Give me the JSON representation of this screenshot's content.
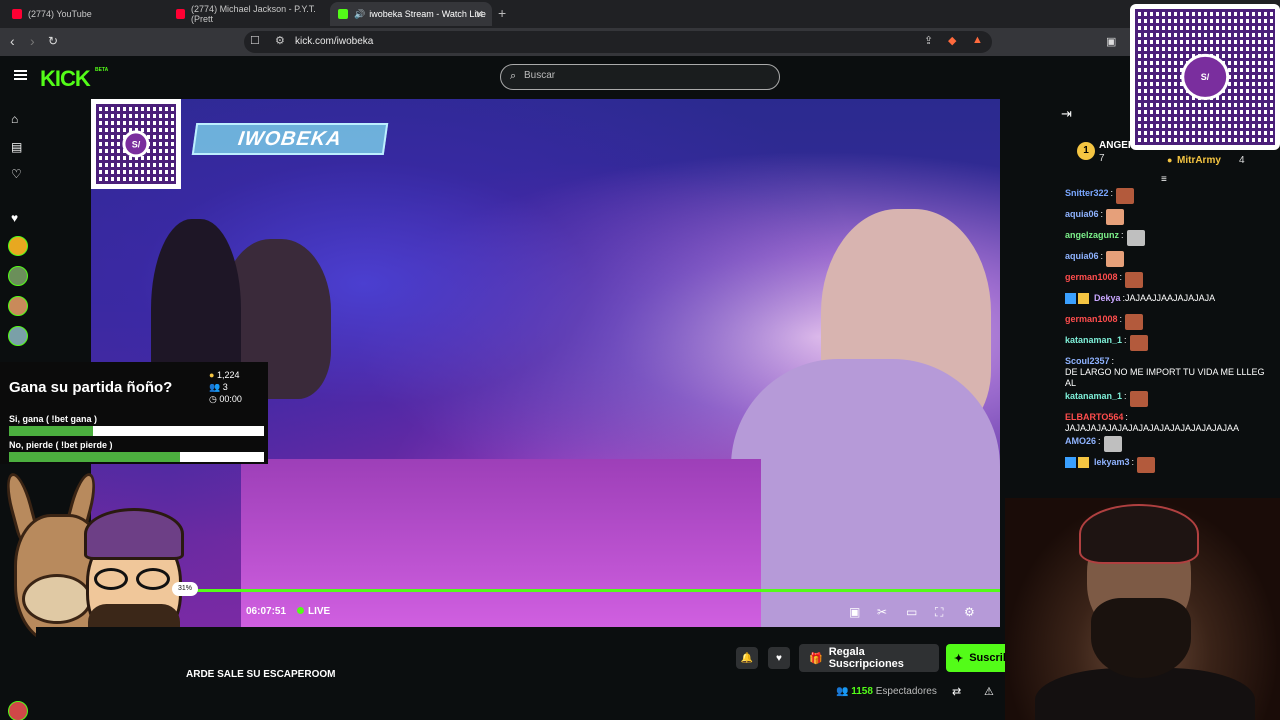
{
  "browser": {
    "tabs": [
      {
        "title": "(2774) YouTube"
      },
      {
        "title": "(2774) Michael Jackson - P.Y.T. (Prett"
      },
      {
        "title": "iwobeka Stream - Watch Live"
      }
    ],
    "url": "kick.com/iwobeka"
  },
  "header": {
    "logo": "KICK",
    "logo_badge": "BETA",
    "search_placeholder": "Buscar"
  },
  "qr": {
    "badge_text": "S/",
    "brand": "yape"
  },
  "video": {
    "channel_banner": "IWOBEKA",
    "elapsed": "06:07:51",
    "live_label": "LIVE"
  },
  "poll": {
    "question": "Gana su partida ñoño?",
    "points": "1,224",
    "participants": "3",
    "timer": "00:00",
    "options": [
      {
        "label": "Si, gana ( !bet gana )",
        "fraction": 0.33
      },
      {
        "label": "No, pierde ( !bet pierde )",
        "fraction": 0.67
      }
    ],
    "bubble": "31%"
  },
  "stream_info": {
    "title_partial": "ARDE SALE SU ESCAPEROOM",
    "gift_label": "Regala Suscripciones",
    "subscribe_label": "Suscrib",
    "viewer_count": "1158",
    "viewer_label": "Espectadores"
  },
  "chat": {
    "top_gifters": [
      {
        "rank": "1",
        "name": "ANGEI",
        "count": "7"
      },
      {
        "rank": "",
        "name": "MitrArmy",
        "count": "4"
      }
    ],
    "messages": [
      {
        "user": "Snitter322",
        "color": "#7aa7ff",
        "text": "",
        "emote": "#b35a3c"
      },
      {
        "user": "aquia06",
        "color": "#8fb3ff",
        "text": "",
        "emote": "#e6a07a"
      },
      {
        "user": "angelzagunz",
        "color": "#7cf08a",
        "text": "",
        "emote": "#bfbfbf"
      },
      {
        "user": "aquia06",
        "color": "#8fb3ff",
        "text": "",
        "emote": "#e6a07a"
      },
      {
        "user": "german1008",
        "color": "#ff4d4d",
        "text": "",
        "emote": "#b35a3c"
      },
      {
        "user": "Dekya",
        "color": "#c9a7ff",
        "text": "JAJAAJJAAJAJAJAJA",
        "emote": "",
        "badges": true
      },
      {
        "user": "german1008",
        "color": "#ff4d4d",
        "text": "",
        "emote": "#b35a3c"
      },
      {
        "user": "katanaman_1",
        "color": "#7ff0d9",
        "text": "",
        "emote": "#b35a3c"
      },
      {
        "user": "Scoul2357",
        "color": "#8fb3ff",
        "text": "DE LARGO NO ME IMPORT TU VIDA ME LLLEG AL",
        "emote": ""
      },
      {
        "user": "katanaman_1",
        "color": "#7ff0d9",
        "text": "",
        "emote": "#b35a3c"
      },
      {
        "user": "ELBARTO564",
        "color": "#ff4d4d",
        "text": "JAJAJAJAJAJAJAJAJAJAJAJAJAJAJAJAA",
        "emote": ""
      },
      {
        "user": "AMO26",
        "color": "#8fb3ff",
        "text": "",
        "emote": "#bfbfbf"
      },
      {
        "user": "lekyam3",
        "color": "#8fb3ff",
        "text": "",
        "emote": "#b35a3c",
        "badges": true
      }
    ]
  },
  "colors": {
    "kick_green": "#53fc18",
    "yape_purple": "#7a2e9e"
  }
}
